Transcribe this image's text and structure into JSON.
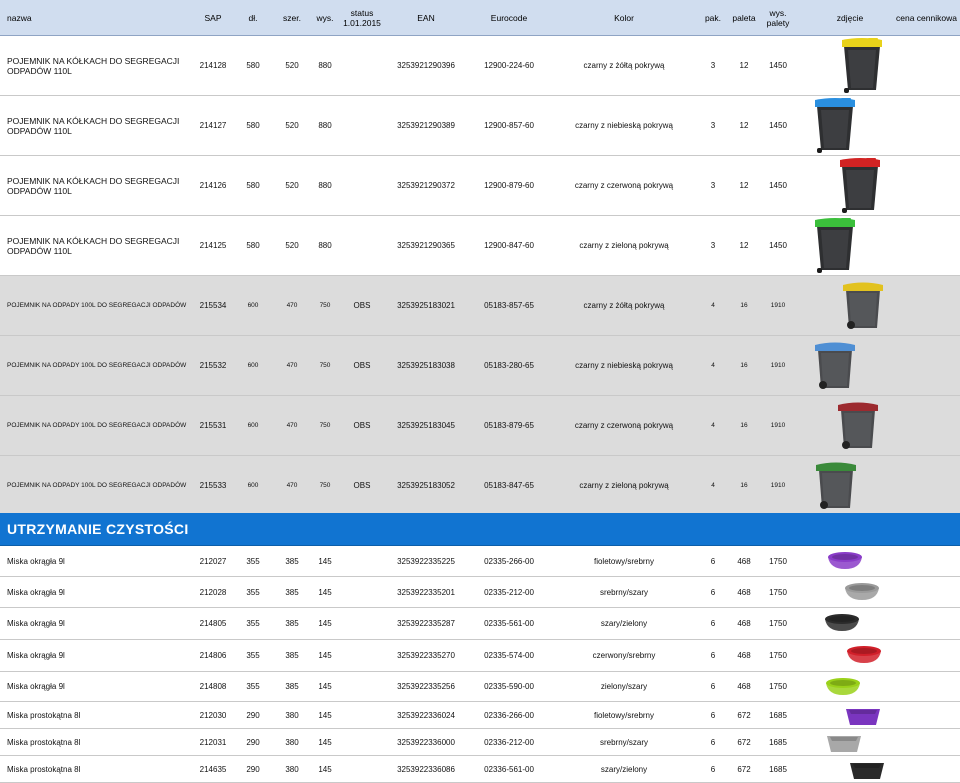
{
  "columns": {
    "name": "nazwa",
    "sap": "SAP",
    "length": "dł.",
    "width": "szer.",
    "height": "wys.",
    "status_line1": "status",
    "status_line2": "1.01.2015",
    "ean": "EAN",
    "eurocode": "Eurocode",
    "color": "Kolor",
    "pack": "pak.",
    "pallet": "paleta",
    "pallet_height_line1": "wys.",
    "pallet_height_line2": "palety",
    "photo": "zdjęcie",
    "price": "cena cennikowa"
  },
  "section_title": "UTRZYMANIE CZYSTOŚCI",
  "rows": [
    {
      "name_l1": "POJEMNIK NA KÓŁKACH DO SEGREGACJI",
      "name_l2": "ODPADÓW 110L",
      "sap": "214128",
      "l": "580",
      "w": "520",
      "h": "880",
      "status": "",
      "ean": "3253921290396",
      "eurocode": "12900-224-60",
      "color": "czarny z żółtą pokrywą",
      "pack": "3",
      "pallet": "12",
      "pallet_h": "1450",
      "lid": "#e8d21a"
    },
    {
      "name_l1": "POJEMNIK NA KÓŁKACH DO SEGREGACJI",
      "name_l2": "ODPADÓW 110L",
      "sap": "214127",
      "l": "580",
      "w": "520",
      "h": "880",
      "status": "",
      "ean": "3253921290389",
      "eurocode": "12900-857-60",
      "color": "czarny z niebieską pokrywą",
      "pack": "3",
      "pallet": "12",
      "pallet_h": "1450",
      "lid": "#2a8fe0"
    },
    {
      "name_l1": "POJEMNIK NA KÓŁKACH DO SEGREGACJI",
      "name_l2": "ODPADÓW 110L",
      "sap": "214126",
      "l": "580",
      "w": "520",
      "h": "880",
      "status": "",
      "ean": "3253921290372",
      "eurocode": "12900-879-60",
      "color": "czarny z czerwoną pokrywą",
      "pack": "3",
      "pallet": "12",
      "pallet_h": "1450",
      "lid": "#d22323"
    },
    {
      "name_l1": "POJEMNIK NA KÓŁKACH DO SEGREGACJI",
      "name_l2": "ODPADÓW 110L",
      "sap": "214125",
      "l": "580",
      "w": "520",
      "h": "880",
      "status": "",
      "ean": "3253921290365",
      "eurocode": "12900-847-60",
      "color": "czarny z zieloną pokrywą",
      "pack": "3",
      "pallet": "12",
      "pallet_h": "1450",
      "lid": "#3bbf3b"
    },
    {
      "name_l1": "POJEMNIK NA ODPADY 100L DO SEGREGACJI ODPADÓW",
      "name_l2": "",
      "sap": "215534",
      "l": "600",
      "w": "470",
      "h": "750",
      "status": "OBS",
      "ean": "3253925183021",
      "eurocode": "05183-857-65",
      "color": "czarny z żółtą pokrywą",
      "pack": "4",
      "pallet": "16",
      "pallet_h": "1910",
      "lid": "#e2c21f"
    },
    {
      "name_l1": "POJEMNIK NA ODPADY 100L DO SEGREGACJI ODPADÓW",
      "name_l2": "",
      "sap": "215532",
      "l": "600",
      "w": "470",
      "h": "750",
      "status": "OBS",
      "ean": "3253925183038",
      "eurocode": "05183-280-65",
      "color": "czarny z niebieską pokrywą",
      "pack": "4",
      "pallet": "16",
      "pallet_h": "1910",
      "lid": "#4f8fd4"
    },
    {
      "name_l1": "POJEMNIK NA ODPADY 100L DO SEGREGACJI ODPADÓW",
      "name_l2": "",
      "sap": "215531",
      "l": "600",
      "w": "470",
      "h": "750",
      "status": "OBS",
      "ean": "3253925183045",
      "eurocode": "05183-879-65",
      "color": "czarny z czerwoną pokrywą",
      "pack": "4",
      "pallet": "16",
      "pallet_h": "1910",
      "lid": "#9c2a2f"
    },
    {
      "name_l1": "POJEMNIK NA ODPADY 100L DO SEGREGACJI ODPADÓW",
      "name_l2": "",
      "sap": "215533",
      "l": "600",
      "w": "470",
      "h": "750",
      "status": "OBS",
      "ean": "3253925183052",
      "eurocode": "05183-847-65",
      "color": "czarny z zieloną pokrywą",
      "pack": "4",
      "pallet": "16",
      "pallet_h": "1910",
      "lid": "#3a8a3a"
    }
  ],
  "rows2": [
    {
      "name": "Miska okrągła 9l",
      "sap": "212027",
      "l": "355",
      "w": "385",
      "h": "145",
      "ean": "3253922335225",
      "eurocode": "02335-266-00",
      "color": "fioletowy/srebrny",
      "pack": "6",
      "pallet": "468",
      "pallet_h": "1750",
      "tint": "#8a3cc8"
    },
    {
      "name": "Miska okrągła 9l",
      "sap": "212028",
      "l": "355",
      "w": "385",
      "h": "145",
      "ean": "3253922335201",
      "eurocode": "02335-212-00",
      "color": "srebrny/szary",
      "pack": "6",
      "pallet": "468",
      "pallet_h": "1750",
      "tint": "#9a9a9a"
    },
    {
      "name": "Miska okrągła 9l",
      "sap": "214805",
      "l": "355",
      "w": "385",
      "h": "145",
      "ean": "3253922335287",
      "eurocode": "02335-561-00",
      "color": "szary/zielony",
      "pack": "6",
      "pallet": "468",
      "pallet_h": "1750",
      "tint": "#2b2b2b"
    },
    {
      "name": "Miska okrągła 9l",
      "sap": "214806",
      "l": "355",
      "w": "385",
      "h": "145",
      "ean": "3253922335270",
      "eurocode": "02335-574-00",
      "color": "czerwony/srebrny",
      "pack": "6",
      "pallet": "468",
      "pallet_h": "1750",
      "tint": "#d1202a"
    },
    {
      "name": "Miska okrągła 9l",
      "sap": "214808",
      "l": "355",
      "w": "385",
      "h": "145",
      "ean": "3253922335256",
      "eurocode": "02335-590-00",
      "color": "zielony/szary",
      "pack": "6",
      "pallet": "468",
      "pallet_h": "1750",
      "tint": "#9ad11a"
    },
    {
      "name": "Miska prostokątna 8l",
      "sap": "212030",
      "l": "290",
      "w": "380",
      "h": "145",
      "ean": "3253922336024",
      "eurocode": "02336-266-00",
      "color": "fioletowy/srebrny",
      "pack": "6",
      "pallet": "672",
      "pallet_h": "1685",
      "tint": "#7a35bf"
    },
    {
      "name": "Miska prostokątna 8l",
      "sap": "212031",
      "l": "290",
      "w": "380",
      "h": "145",
      "ean": "3253922336000",
      "eurocode": "02336-212-00",
      "color": "srebrny/szary",
      "pack": "6",
      "pallet": "672",
      "pallet_h": "1685",
      "tint": "#a8a8a8"
    },
    {
      "name": "Miska prostokątna 8l",
      "sap": "214635",
      "l": "290",
      "w": "380",
      "h": "145",
      "ean": "3253922336086",
      "eurocode": "02336-561-00",
      "color": "szary/zielony",
      "pack": "6",
      "pallet": "672",
      "pallet_h": "1685",
      "tint": "#2a2a2a"
    }
  ]
}
